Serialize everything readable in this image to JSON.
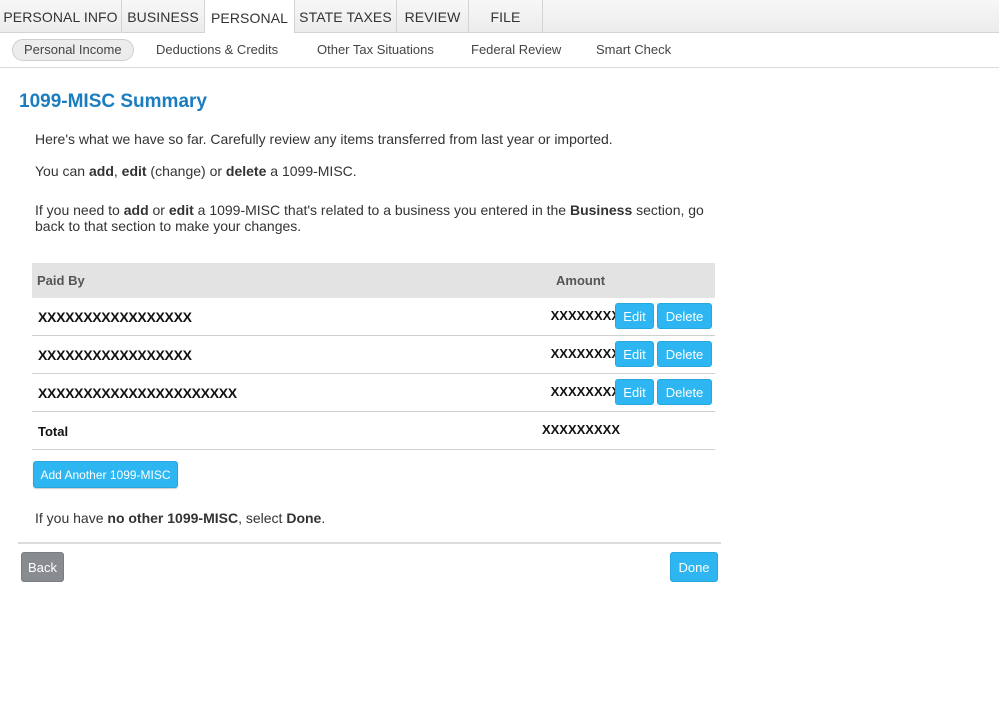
{
  "top_tabs": {
    "personal_info": "PERSONAL INFO",
    "business": "BUSINESS",
    "personal": "PERSONAL",
    "state_taxes": "STATE TAXES",
    "review": "REVIEW",
    "file": "FILE",
    "active": "PERSONAL"
  },
  "sub_nav": {
    "personal_income": "Personal Income",
    "deductions_credits": "Deductions & Credits",
    "other_tax_situations": "Other Tax Situations",
    "federal_review": "Federal Review",
    "smart_check": "Smart Check",
    "active": "Personal Income"
  },
  "page": {
    "title": "1099-MISC Summary",
    "intro": "Here's what we have so far. Carefully review any items transferred from last year or imported.",
    "line2": {
      "a": "You can ",
      "add": "add",
      "b": ", ",
      "edit": "edit",
      "c": " (change) or ",
      "delete": "delete",
      "d": " a 1099-MISC."
    },
    "line3": {
      "a": "If you need to ",
      "add": "add",
      "b": " or ",
      "edit": "edit",
      "c": " a 1099-MISC that's related to a business you entered in the ",
      "business": "Business",
      "d": " section, go back to that section to make your changes."
    },
    "closing": {
      "a": "If you have ",
      "none": "no other 1099-MISC",
      "b": ", select ",
      "done": "Done",
      "c": "."
    }
  },
  "table": {
    "headers": {
      "paid_by": "Paid By",
      "amount": "Amount"
    },
    "rows": [
      {
        "paid_by": "XXXXXXXXXXXXXXXXX",
        "amount": "XXXXXXXX",
        "edit": "Edit",
        "delete": "Delete"
      },
      {
        "paid_by": "XXXXXXXXXXXXXXXXX",
        "amount": "XXXXXXXX",
        "edit": "Edit",
        "delete": "Delete"
      },
      {
        "paid_by": "XXXXXXXXXXXXXXXXXXXXXX",
        "amount": "XXXXXXXX",
        "edit": "Edit",
        "delete": "Delete"
      }
    ],
    "total": {
      "label": "Total",
      "amount": "XXXXXXXXX"
    }
  },
  "buttons": {
    "add_another": "Add Another 1099-MISC",
    "back": "Back",
    "done": "Done"
  }
}
